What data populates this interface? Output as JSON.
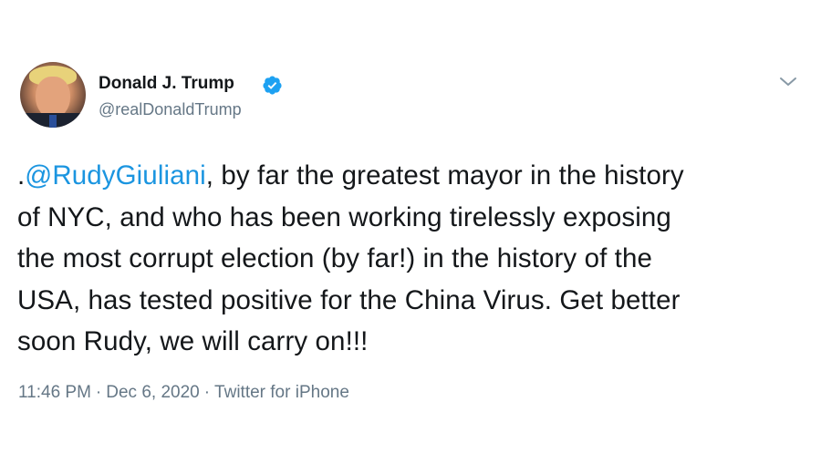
{
  "author": {
    "display_name": "Donald J. Trump",
    "handle": "@realDonaldTrump",
    "verified": true,
    "avatar_icon": "profile-photo"
  },
  "menu": {
    "icon": "chevron-down-icon"
  },
  "tweet": {
    "lead": ".",
    "mention": "@RudyGiuliani",
    "lines": [
      ", by far the greatest mayor in the history",
      "of NYC, and who has been working tirelessly exposing",
      "the most corrupt election (by far!) in the history of the",
      "USA, has tested positive for the China Virus. Get better",
      "soon Rudy, we will carry on!!!"
    ]
  },
  "meta": {
    "time": "11:46 PM",
    "separator": "·",
    "date": "Dec 6, 2020",
    "source": "Twitter for iPhone"
  },
  "colors": {
    "verified_blue": "#1da1f2",
    "mention_blue": "#1b95e0",
    "secondary_text": "#657786",
    "primary_text": "#14171a"
  }
}
